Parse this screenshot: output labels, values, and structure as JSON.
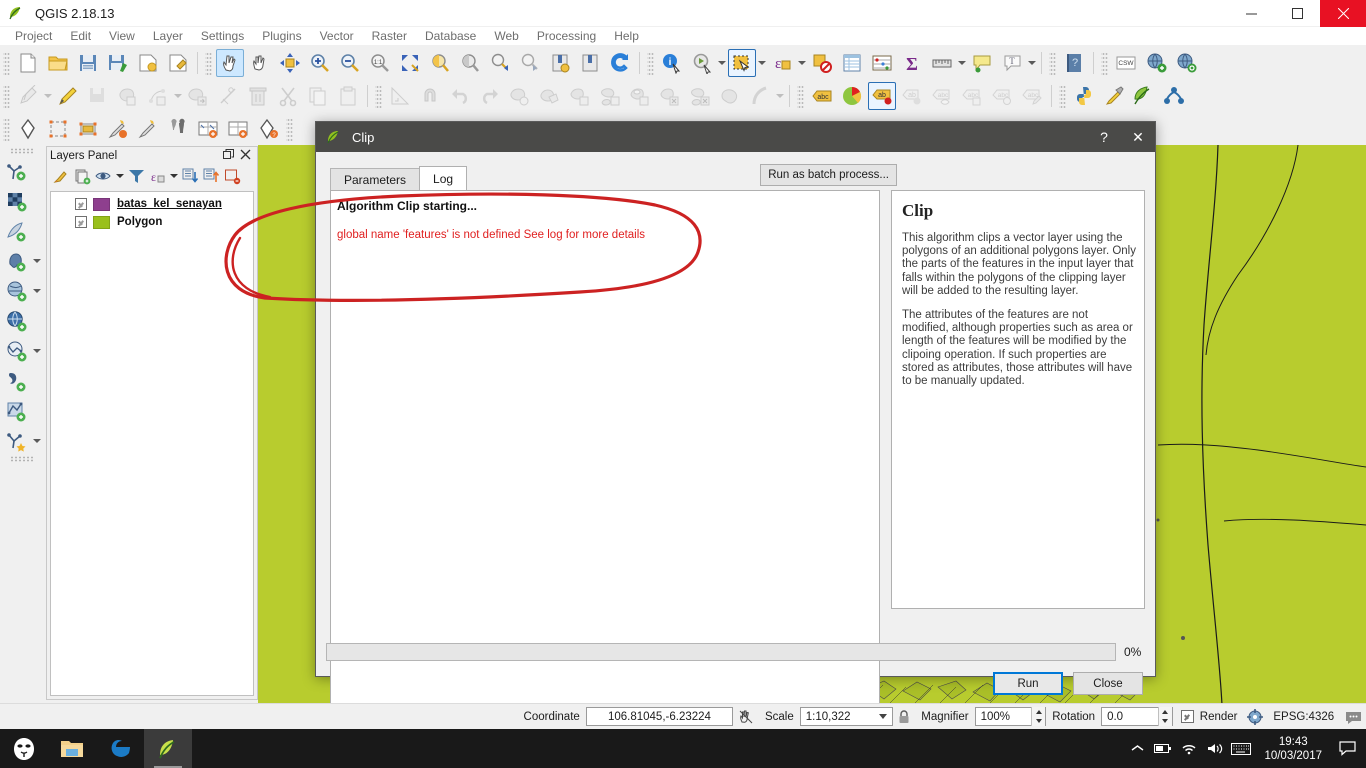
{
  "window": {
    "title": "QGIS 2.18.13",
    "minimize_label": "Minimize",
    "maximize_label": "Maximize",
    "close_label": "Close"
  },
  "menubar": {
    "items": [
      {
        "label": "Project"
      },
      {
        "label": "Edit"
      },
      {
        "label": "View"
      },
      {
        "label": "Layer"
      },
      {
        "label": "Settings"
      },
      {
        "label": "Plugins"
      },
      {
        "label": "Vector"
      },
      {
        "label": "Raster"
      },
      {
        "label": "Database"
      },
      {
        "label": "Web"
      },
      {
        "label": "Processing"
      },
      {
        "label": "Help"
      }
    ]
  },
  "toolbars": {
    "row1": [
      {
        "name": "new-project-icon"
      },
      {
        "name": "open-project-icon"
      },
      {
        "name": "save-project-icon"
      },
      {
        "name": "save-project-as-icon"
      },
      {
        "name": "new-print-composer-icon"
      },
      {
        "name": "composer-manager-icon"
      },
      {
        "name": "pan-map-touch-icon"
      },
      {
        "name": "pan-map-icon"
      },
      {
        "name": "pan-to-selection-icon"
      },
      {
        "name": "zoom-in-icon"
      },
      {
        "name": "zoom-out-icon"
      },
      {
        "name": "zoom-native-icon"
      },
      {
        "name": "zoom-full-icon"
      },
      {
        "name": "zoom-to-selection-icon"
      },
      {
        "name": "zoom-to-layer-icon"
      },
      {
        "name": "zoom-last-icon"
      },
      {
        "name": "zoom-next-icon"
      },
      {
        "name": "new-bookmark-icon"
      },
      {
        "name": "show-bookmarks-icon"
      },
      {
        "name": "refresh-icon"
      },
      {
        "name": "identify-features-icon"
      },
      {
        "name": "run-feature-action-icon"
      },
      {
        "name": "select-features-icon"
      },
      {
        "name": "select-by-expression-icon"
      },
      {
        "name": "deselect-features-icon"
      },
      {
        "name": "open-attribute-table-icon"
      },
      {
        "name": "field-calculator-icon"
      },
      {
        "name": "statistical-summary-icon"
      },
      {
        "name": "measure-line-icon"
      },
      {
        "name": "map-tips-icon"
      },
      {
        "name": "text-annotation-icon"
      },
      {
        "name": "help-contents-icon"
      },
      {
        "name": "metasearch-csw-icon"
      },
      {
        "name": "add-wms-layer-icon"
      },
      {
        "name": "wms-identify-icon"
      }
    ],
    "row2": [
      {
        "name": "current-edits-icon"
      },
      {
        "name": "toggle-editing-icon"
      },
      {
        "name": "save-layer-edits-icon"
      },
      {
        "name": "add-feature-icon"
      },
      {
        "name": "add-part-icon"
      },
      {
        "name": "move-feature-icon"
      },
      {
        "name": "node-tool-icon"
      },
      {
        "name": "delete-selected-icon"
      },
      {
        "name": "cut-features-icon"
      },
      {
        "name": "copy-features-icon"
      },
      {
        "name": "paste-features-icon"
      },
      {
        "name": "advanced-digitizing-icon"
      },
      {
        "name": "enable-snapping-icon"
      },
      {
        "name": "undo-icon"
      },
      {
        "name": "redo-icon"
      },
      {
        "name": "rotate-feature-icon"
      },
      {
        "name": "simplify-feature-icon"
      },
      {
        "name": "add-ring-icon"
      },
      {
        "name": "add-part-feature-icon"
      },
      {
        "name": "fill-ring-icon"
      },
      {
        "name": "delete-ring-icon"
      },
      {
        "name": "delete-part-icon"
      },
      {
        "name": "reshape-features-icon"
      },
      {
        "name": "offset-curve-icon"
      },
      {
        "name": "label-toolbar-icon"
      },
      {
        "name": "style-manager-icon"
      },
      {
        "name": "highlight-pinned-labels-icon"
      },
      {
        "name": "pin-labels-icon"
      },
      {
        "name": "show-hide-labels-icon"
      },
      {
        "name": "move-label-icon"
      },
      {
        "name": "rotate-label-icon"
      },
      {
        "name": "change-label-icon"
      },
      {
        "name": "python-console-icon"
      },
      {
        "name": "plugin-builder-icon"
      },
      {
        "name": "qgis-plugin-icon"
      },
      {
        "name": "processing-toolbox-icon"
      }
    ],
    "row3": [
      {
        "name": "new-shapefile-layer-icon"
      },
      {
        "name": "new-spatialite-layer-icon"
      },
      {
        "name": "new-geopackage-layer-icon"
      },
      {
        "name": "new-memory-layer-icon"
      },
      {
        "name": "new-virtual-layer-icon"
      },
      {
        "name": "georeferencer-icon"
      },
      {
        "name": "open-field-calculator-icon"
      },
      {
        "name": "add-delimited-text-icon"
      },
      {
        "name": "add-vector-layer-icon"
      }
    ],
    "vertical": [
      {
        "name": "add-vector-layer-icon"
      },
      {
        "name": "add-raster-layer-icon"
      },
      {
        "name": "add-mssql-layer-icon"
      },
      {
        "name": "add-postgis-layer-icon"
      },
      {
        "name": "add-wms-wmts-layer-icon"
      },
      {
        "name": "add-wcs-layer-icon"
      },
      {
        "name": "add-wfs-layer-icon"
      },
      {
        "name": "add-spatialite-layer-icon"
      },
      {
        "name": "add-delimited-text-layer-icon"
      },
      {
        "name": "add-virtual-layer-icon"
      }
    ]
  },
  "layers_panel": {
    "title": "Layers Panel",
    "toolbar": [
      {
        "name": "open-layer-styling-icon"
      },
      {
        "name": "add-group-icon"
      },
      {
        "name": "manage-visibility-icon"
      },
      {
        "name": "filter-legend-icon"
      },
      {
        "name": "expression-filter-icon"
      },
      {
        "name": "expand-all-icon"
      },
      {
        "name": "collapse-all-icon"
      },
      {
        "name": "remove-layer-icon"
      }
    ],
    "layers": [
      {
        "name": "batas_kel_senayan",
        "color": "#8e3f8e",
        "checked": true,
        "active": true
      },
      {
        "name": "Polygon",
        "color": "#9ac01c",
        "checked": true,
        "active": false
      }
    ]
  },
  "dialog": {
    "title": "Clip",
    "help_button": "?",
    "close_button": "✕",
    "tabs": [
      {
        "label": "Parameters",
        "active": false
      },
      {
        "label": "Log",
        "active": true
      }
    ],
    "batch_button": "Run as batch process...",
    "log": {
      "heading": "Algorithm Clip starting...",
      "error": "global name 'features' is not defined See log for more details",
      "error_color": "#e02020"
    },
    "help": {
      "title": "Clip",
      "paragraphs": [
        "This algorithm clips a vector layer using the polygons of an additional polygons layer. Only the parts of the features in the input layer that falls within the polygons of the clipping layer will be added to the resulting layer.",
        "The attributes of the features are not modified, although properties such as area or length of the features will be modified by the clipoing operation. If such properties are stored as attributes, those attributes will have to be manually updated."
      ]
    },
    "progress": {
      "value": 0,
      "label": "0%"
    },
    "buttons": [
      {
        "label": "Run",
        "primary": true
      },
      {
        "label": "Close",
        "primary": false
      }
    ]
  },
  "statusbar": {
    "coordinate_label": "Coordinate",
    "coordinate_value": "106.81045,-6.23224",
    "toggle_extents_icon": "toggle-extents-icon",
    "scale_label": "Scale",
    "scale_value": "1:10,322",
    "lock_icon": "lock-scale-icon",
    "magnifier_label": "Magnifier",
    "magnifier_value": "100%",
    "rotation_label": "Rotation",
    "rotation_value": "0.0",
    "render_label": "Render",
    "render_checked": true,
    "crs_label": "EPSG:4326",
    "messages_icon": "messages-icon"
  },
  "taskbar": {
    "items": [
      {
        "name": "start-button",
        "label": "Start"
      },
      {
        "name": "file-explorer-button",
        "label": "File Explorer"
      },
      {
        "name": "edge-browser-button",
        "label": "Microsoft Edge"
      },
      {
        "name": "qgis-taskbar-button",
        "label": "QGIS"
      }
    ],
    "tray": [
      {
        "name": "show-hidden-icons-icon"
      },
      {
        "name": "battery-icon"
      },
      {
        "name": "wifi-icon"
      },
      {
        "name": "volume-icon"
      },
      {
        "name": "keyboard-icon"
      }
    ],
    "time": "19:43",
    "date": "10/03/2017",
    "action_center_icon": "action-center-icon"
  },
  "annotation": {
    "color": "#cc2222",
    "description": "hand-drawn red ellipse around the log messages"
  }
}
